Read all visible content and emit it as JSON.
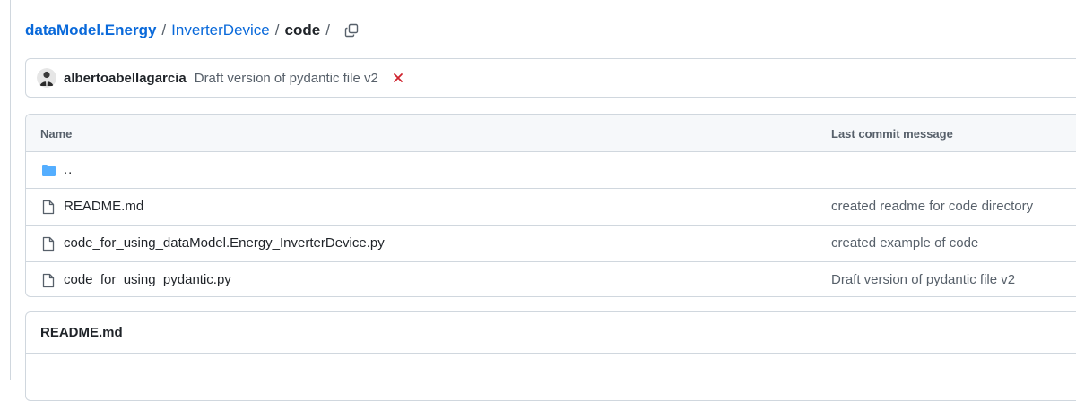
{
  "breadcrumb": {
    "root": "dataModel.Energy",
    "sep1": "/",
    "folder": "InverterDevice",
    "sep2": "/",
    "current": "code",
    "sep3": "/"
  },
  "latest_commit": {
    "author": "albertoabellagarcia",
    "message": "Draft version of pydantic file v2",
    "status": "failure",
    "status_color": "#cf222e"
  },
  "file_table": {
    "headers": {
      "name": "Name",
      "last_commit_message": "Last commit message"
    },
    "rows": [
      {
        "type": "parent-dir",
        "name": "..",
        "message": ""
      },
      {
        "type": "file",
        "name": "README.md",
        "message": "created readme for code directory"
      },
      {
        "type": "file",
        "name": "code_for_using_dataModel.Energy_InverterDevice.py",
        "message": "created example of code"
      },
      {
        "type": "file",
        "name": "code_for_using_pydantic.py",
        "message": "Draft version of pydantic file v2"
      }
    ]
  },
  "readme": {
    "title": "README.md"
  },
  "icons": {
    "copy": "copy-icon",
    "folder": "folder-icon",
    "file": "file-icon",
    "status": "x-icon"
  },
  "colors": {
    "link": "#0969da",
    "folder": "#54aeff",
    "muted": "#57606a",
    "border": "#d0d7de",
    "failure": "#cf222e"
  }
}
